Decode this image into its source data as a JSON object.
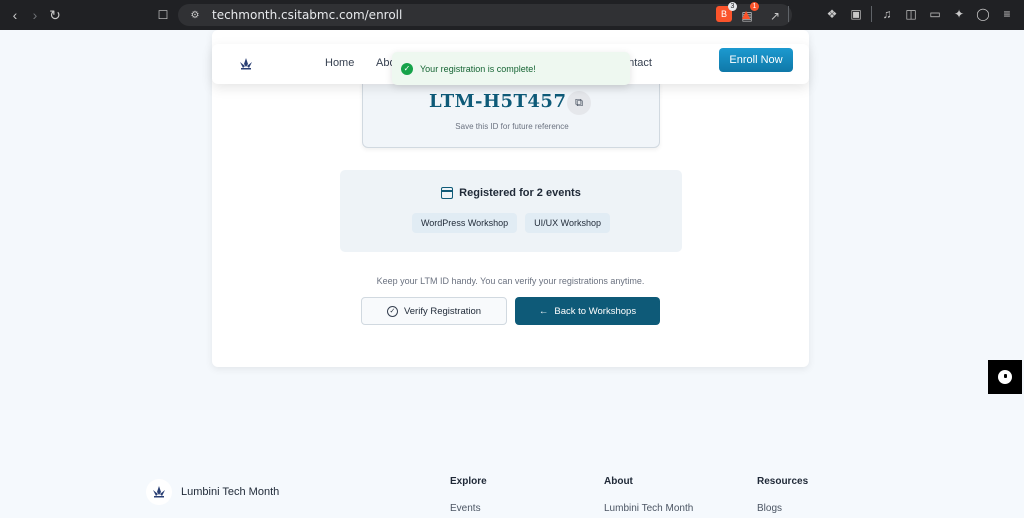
{
  "browser": {
    "url": "techmonth.csitabmc.com/enroll",
    "brave_shield_count": "3",
    "alert_count": "1"
  },
  "navbar": {
    "links": [
      "Home",
      "Abo",
      "ontact"
    ],
    "enroll_label": "Enroll Now"
  },
  "toast": {
    "message": "Your registration is complete!"
  },
  "registration": {
    "ltm_id": "LTM-H5T457",
    "hint": "Save this ID for future reference"
  },
  "events": {
    "heading": "Registered for 2 events",
    "items": [
      "WordPress Workshop",
      "UI/UX Workshop"
    ]
  },
  "note": "Keep your LTM ID handy. You can verify your registrations anytime.",
  "actions": {
    "verify_label": "Verify Registration",
    "back_label": "Back to Workshops"
  },
  "footer": {
    "brand": "Lumbini Tech Month",
    "columns": [
      {
        "title": "Explore",
        "first_link": "Events"
      },
      {
        "title": "About",
        "first_link": "Lumbini Tech Month"
      },
      {
        "title": "Resources",
        "first_link": "Blogs"
      }
    ]
  },
  "colors": {
    "primary": "#0e5a78",
    "accent": "#1c9ad0",
    "success": "#16a34a"
  }
}
